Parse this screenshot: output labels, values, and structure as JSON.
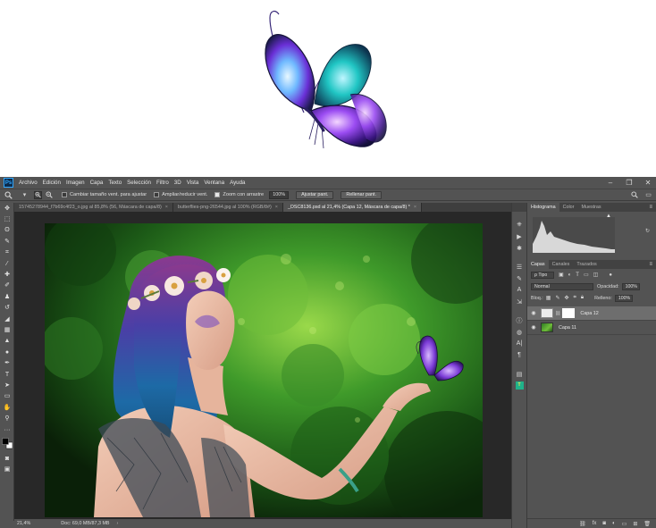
{
  "app": {
    "logo_text": "Ps"
  },
  "menu": [
    "Archivo",
    "Edición",
    "Imagen",
    "Capa",
    "Texto",
    "Selección",
    "Filtro",
    "3D",
    "Vista",
    "Ventana",
    "Ayuda"
  ],
  "window_controls": [
    "–",
    "❐",
    "✕"
  ],
  "options_bar": {
    "resize_windows_label": "Cambiar tamaño vent. para ajustar",
    "resize_windows_checked": false,
    "zoom_all_label": "Ampliar/reducir vent.",
    "zoom_all_checked": false,
    "scrubby_zoom_label": "Zoom con arrastre",
    "scrubby_zoom_checked": true,
    "zoom_value": "100%",
    "fit_screen_label": "Ajustar pant.",
    "fill_screen_label": "Rellenar pant."
  },
  "tabs": [
    {
      "label": "15745278944_f7b69c4f23_o.jpg al 85,8% (56, Máscara de capa/8)",
      "active": false
    },
    {
      "label": "butterflies-png-26544.jpg al 100% (RGB/8#)",
      "active": false
    },
    {
      "label": "_DSC8136.psd al 21,4% (Capa 12, Máscara de capa/8) *",
      "active": true
    }
  ],
  "status": {
    "zoom": "21,4%",
    "doc": "Doc: 69,0 MB/87,3 MB"
  },
  "panels": {
    "top_tabs": [
      "Histograma",
      "Color",
      "Muestras"
    ],
    "layer_tabs": [
      "Capas",
      "Canales",
      "Trazados"
    ],
    "filter_kind": "ρ Tipo",
    "blend_mode": "Normal",
    "opacity_label": "Opacidad:",
    "opacity_value": "100%",
    "lock_label": "Bloq.:",
    "fill_label": "Relleno:",
    "fill_value": "100%"
  },
  "layers": [
    {
      "name": "Capa 12",
      "selected": true,
      "has_mask": true
    },
    {
      "name": "Capa 11",
      "selected": false,
      "has_mask": false
    }
  ],
  "colors": {
    "ps_bg": "#535353",
    "ps_dark": "#3e3e3e",
    "canvas_bg": "#282828",
    "accent_blue": "#31a8ff"
  }
}
